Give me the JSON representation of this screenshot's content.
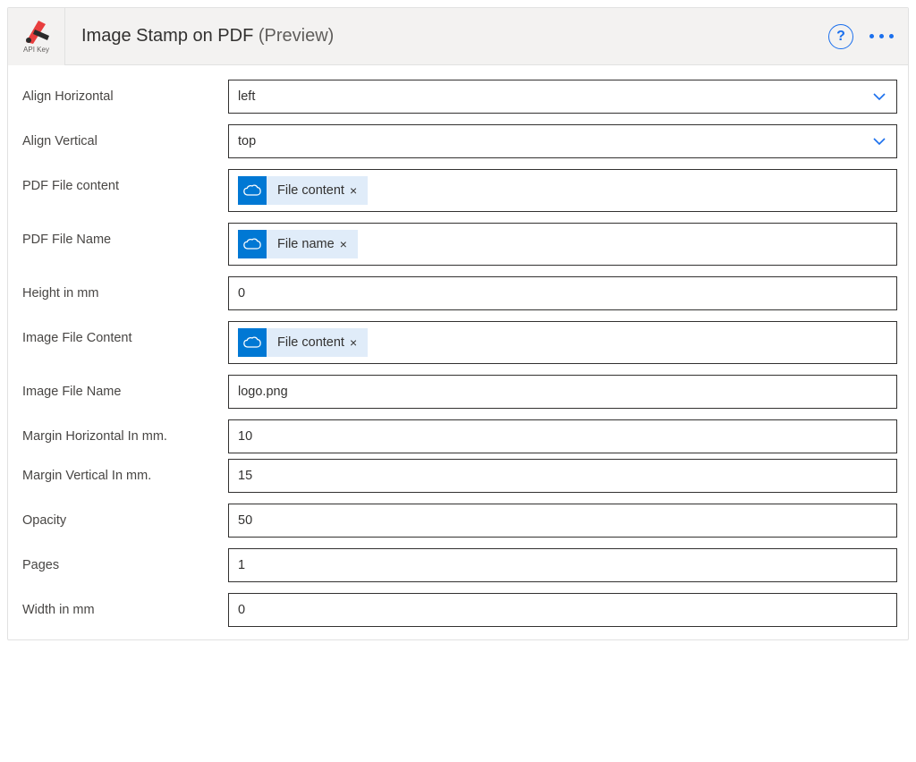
{
  "header": {
    "api_key_label": "API Key",
    "title": "Image Stamp on PDF",
    "title_suffix": "(Preview)"
  },
  "fields": {
    "align_horizontal": {
      "label": "Align Horizontal",
      "value": "left"
    },
    "align_vertical": {
      "label": "Align Vertical",
      "value": "top"
    },
    "pdf_file_content": {
      "label": "PDF File content",
      "token": "File content"
    },
    "pdf_file_name": {
      "label": "PDF File Name",
      "token": "File name"
    },
    "height_mm": {
      "label": "Height in mm",
      "value": "0"
    },
    "image_file_content": {
      "label": "Image File Content",
      "token": "File content"
    },
    "image_file_name": {
      "label": "Image File Name",
      "value": "logo.png"
    },
    "margin_horizontal": {
      "label": "Margin Horizontal In mm.",
      "value": "10"
    },
    "margin_vertical": {
      "label": "Margin Vertical In mm.",
      "value": "15"
    },
    "opacity": {
      "label": "Opacity",
      "value": "50"
    },
    "pages": {
      "label": "Pages",
      "value": "1"
    },
    "width_mm": {
      "label": "Width in mm",
      "value": "0"
    }
  }
}
